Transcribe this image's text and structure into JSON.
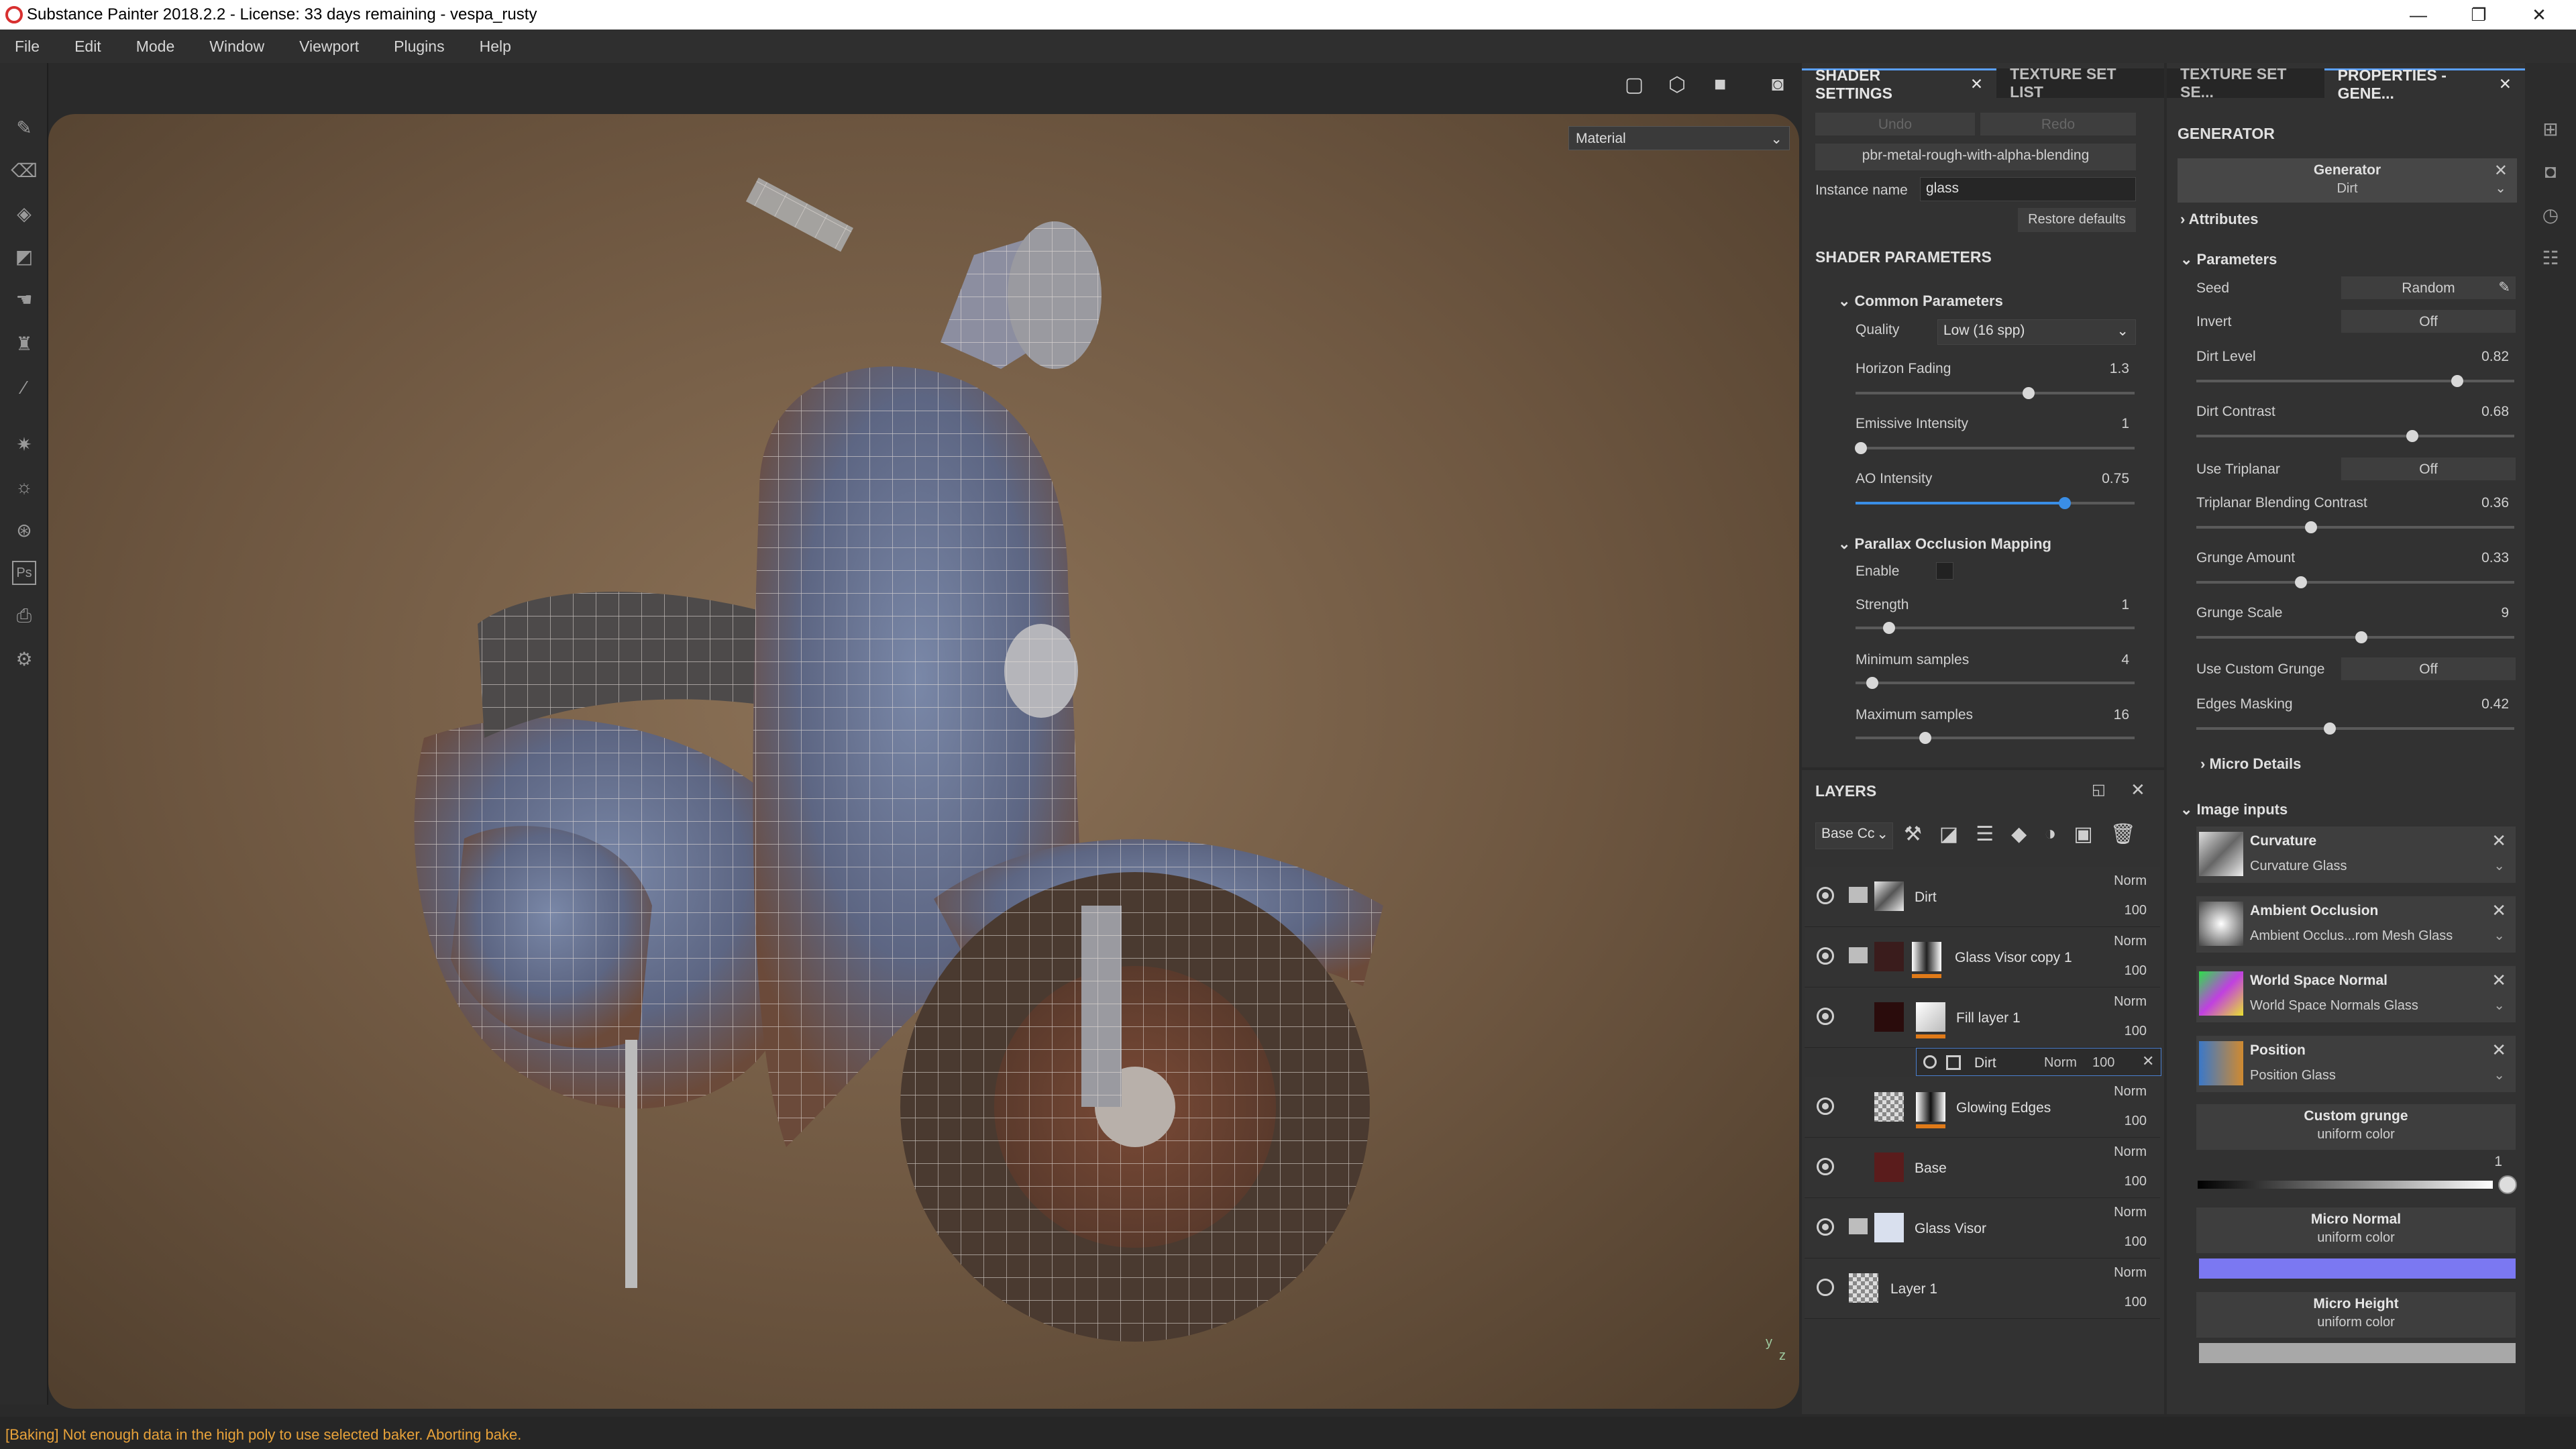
{
  "window": {
    "title": "Substance Painter 2018.2.2 - License: 33 days remaining - vespa_rusty",
    "minimize": "—",
    "maximize": "❐",
    "close": "✕"
  },
  "menu": [
    "File",
    "Edit",
    "Mode",
    "Window",
    "Viewport",
    "Plugins",
    "Help"
  ],
  "viewport": {
    "material_select": "Material",
    "axis_y": "y",
    "axis_z": "z"
  },
  "status": "[Baking] Not enough data in the high poly to use selected baker. Aborting bake.",
  "shader_panel": {
    "tab_shader": "SHADER SETTINGS",
    "tab_texture": "TEXTURE SET LIST",
    "undo": "Undo",
    "redo": "Redo",
    "shader_name": "pbr-metal-rough-with-alpha-blending",
    "instance_label": "Instance name",
    "instance_value": "glass",
    "restore": "Restore defaults",
    "params_header": "SHADER PARAMETERS",
    "common_header": "Common Parameters",
    "quality_label": "Quality",
    "quality_value": "Low (16 spp)",
    "horizon_label": "Horizon Fading",
    "horizon_value": "1.3",
    "horizon_frac": 0.62,
    "emissive_label": "Emissive Intensity",
    "emissive_value": "1",
    "emissive_frac": 0.02,
    "ao_label": "AO Intensity",
    "ao_value": "0.75",
    "ao_frac": 0.75,
    "pom_header": "Parallax Occlusion Mapping",
    "enable_label": "Enable",
    "strength_label": "Strength",
    "strength_value": "1",
    "strength_frac": 0.12,
    "min_label": "Minimum samples",
    "min_value": "4",
    "min_frac": 0.06,
    "max_label": "Maximum samples",
    "max_value": "16",
    "max_frac": 0.25
  },
  "layers": {
    "header": "LAYERS",
    "channel": "Base Cc",
    "items": [
      {
        "name": "Dirt",
        "blend": "Norm",
        "opacity": "100"
      },
      {
        "name": "Glass Visor copy 1",
        "blend": "Norm",
        "opacity": "100"
      },
      {
        "name": "Fill layer 1",
        "blend": "Norm",
        "opacity": "100"
      },
      {
        "name": "Dirt",
        "blend": "Norm",
        "opacity": "100"
      },
      {
        "name": "Glowing Edges",
        "blend": "Norm",
        "opacity": "100"
      },
      {
        "name": "Base",
        "blend": "Norm",
        "opacity": "100"
      },
      {
        "name": "Glass Visor",
        "blend": "Norm",
        "opacity": "100"
      },
      {
        "name": "Layer 1",
        "blend": "Norm",
        "opacity": "100"
      }
    ]
  },
  "props": {
    "tab_textureset": "TEXTURE SET SE...",
    "tab_props": "PROPERTIES - GENE...",
    "generator_header": "GENERATOR",
    "gen_title": "Generator",
    "gen_value": "Dirt",
    "attributes": "Attributes",
    "parameters": "Parameters",
    "seed_label": "Seed",
    "seed_value": "Random",
    "invert_label": "Invert",
    "invert_value": "Off",
    "dirt_level_label": "Dirt Level",
    "dirt_level_value": "0.82",
    "dirt_level_frac": 0.82,
    "dirt_contrast_label": "Dirt Contrast",
    "dirt_contrast_value": "0.68",
    "dirt_contrast_frac": 0.68,
    "triplanar_label": "Use Triplanar",
    "triplanar_value": "Off",
    "tri_blend_label": "Triplanar Blending Contrast",
    "tri_blend_value": "0.36",
    "tri_blend_frac": 0.36,
    "grunge_amount_label": "Grunge Amount",
    "grunge_amount_value": "0.33",
    "grunge_amount_frac": 0.33,
    "grunge_scale_label": "Grunge Scale",
    "grunge_scale_value": "9",
    "grunge_scale_frac": 0.52,
    "custom_grunge_label": "Use Custom Grunge",
    "custom_grunge_value": "Off",
    "edges_label": "Edges Masking",
    "edges_value": "0.42",
    "edges_frac": 0.42,
    "micro_details": "Micro Details",
    "image_inputs": "Image inputs",
    "inputs": [
      {
        "title": "Curvature",
        "sub": "Curvature Glass"
      },
      {
        "title": "Ambient Occlusion",
        "sub": "Ambient Occlus...rom Mesh Glass"
      },
      {
        "title": "World Space Normal",
        "sub": "World Space Normals Glass"
      },
      {
        "title": "Position",
        "sub": "Position Glass"
      }
    ],
    "custom_grunge": "Custom grunge",
    "uniform_color": "uniform color",
    "grad_value": "1",
    "micro_normal": "Micro Normal",
    "micro_height": "Micro Height",
    "micro_normal_color": "#7b78f2",
    "micro_height_color": "#a8a8a8"
  },
  "icons": {
    "tools": [
      "brush-icon",
      "eraser-icon",
      "projection-icon",
      "polygon-fill-icon",
      "smudge-icon",
      "clone-icon",
      "picker-icon",
      "bake-icon",
      "light-icon",
      "shelf-icon",
      "photoshop-icon",
      "export-icon",
      "settings-icon"
    ]
  }
}
